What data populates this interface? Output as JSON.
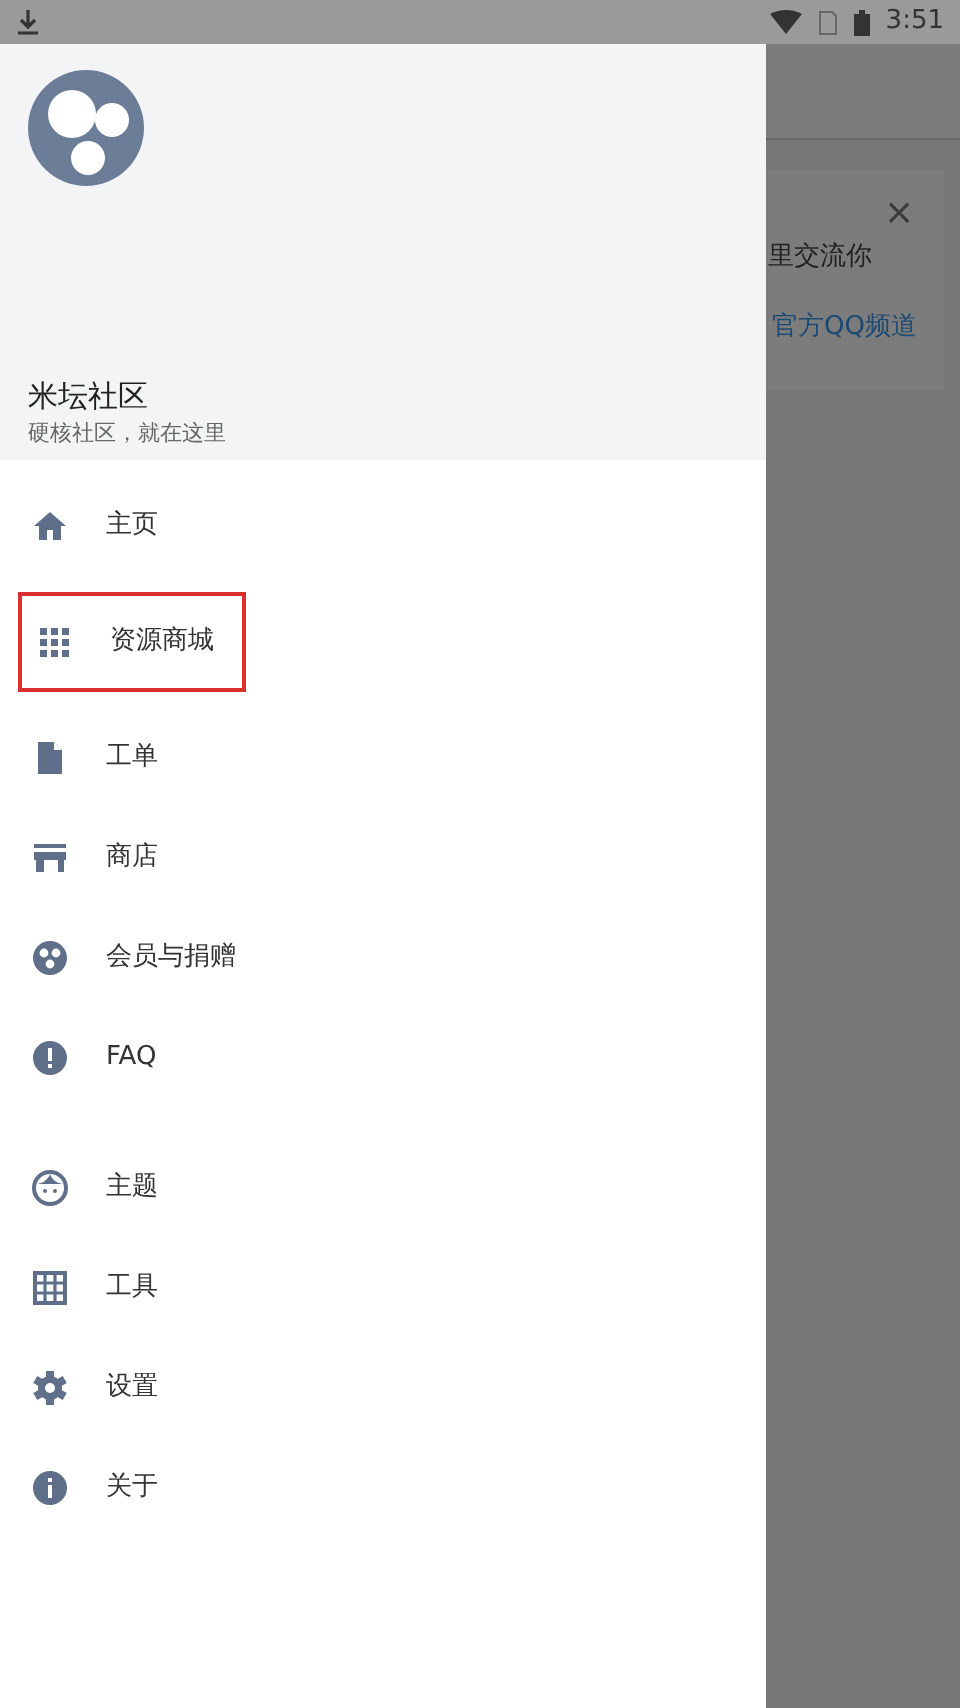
{
  "status_bar": {
    "time": "3:51"
  },
  "background": {
    "card_text": "里交流你",
    "card_link": "官方QQ频道",
    "close": "×"
  },
  "drawer": {
    "title": "米坛社区",
    "subtitle": "硬核社区，就在这里",
    "groups": [
      [
        {
          "label": "主页",
          "highlighted": false
        },
        {
          "label": "资源商城",
          "highlighted": true
        },
        {
          "label": "工单",
          "highlighted": false
        },
        {
          "label": "商店",
          "highlighted": false
        },
        {
          "label": "会员与捐赠",
          "highlighted": false
        },
        {
          "label": "FAQ",
          "highlighted": false
        }
      ],
      [
        {
          "label": "主题",
          "highlighted": false
        },
        {
          "label": "工具",
          "highlighted": false
        },
        {
          "label": "设置",
          "highlighted": false
        },
        {
          "label": "关于",
          "highlighted": false
        }
      ]
    ]
  }
}
